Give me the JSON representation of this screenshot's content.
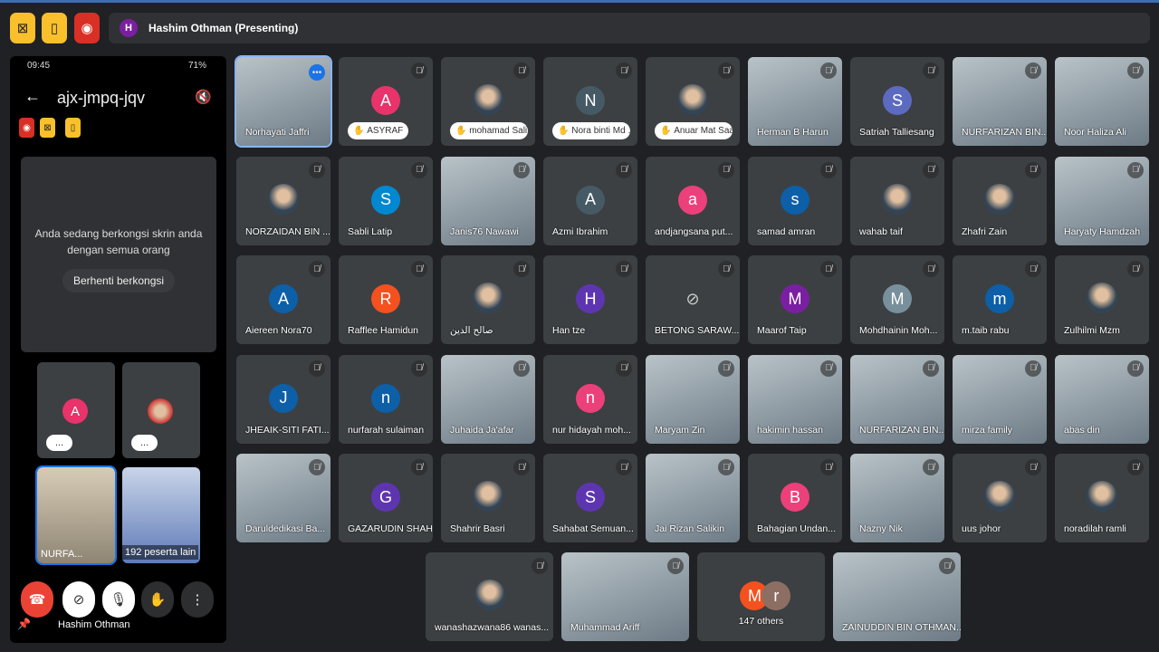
{
  "header": {
    "presenter_initial": "H",
    "presenter_label": "Hashim Othman (Presenting)",
    "icons": [
      "no-screen-icon",
      "door-icon",
      "record-icon"
    ],
    "colors": {
      "yellow": "#f9c02b",
      "red": "#d93025"
    }
  },
  "phone": {
    "time": "09:45",
    "battery": "71%",
    "meeting_code": "ajx-jmpq-jqv",
    "share_message": "Anda sedang berkongsi skrin anda dengan semua orang",
    "stop_sharing": "Berhenti berkongsi",
    "tiles": [
      {
        "letter": "A",
        "label": "...",
        "color": "#e8336b"
      },
      {
        "label": "..."
      },
      {
        "label": "NURFA..."
      },
      {
        "label": "192 peserta lain"
      }
    ],
    "self_name": "Hashim Othman"
  },
  "tiles": [
    {
      "name": "Norhayati Jaffri",
      "kind": "video",
      "sel": true
    },
    {
      "name": "ASYRAF",
      "kind": "avatar",
      "letter": "A",
      "color": "#e8336b",
      "hand": true
    },
    {
      "name": "mohamad Sali...",
      "kind": "photo",
      "hand": true
    },
    {
      "name": "Nora binti Md ...",
      "kind": "avatar",
      "letter": "N",
      "color": "#455a64",
      "hand": true
    },
    {
      "name": "Anuar Mat Saad",
      "kind": "photo",
      "hand": true
    },
    {
      "name": "Herman B Harun",
      "kind": "video"
    },
    {
      "name": "Satriah Talliesang",
      "kind": "avatar",
      "letter": "S",
      "color": "#5c6bc0"
    },
    {
      "name": "NURFARIZAN BIN...",
      "kind": "video"
    },
    {
      "name": "Noor Haliza Ali",
      "kind": "video"
    },
    {
      "name": "NORZAIDAN BIN ...",
      "kind": "photo"
    },
    {
      "name": "Sabli Latip",
      "kind": "avatar",
      "letter": "S",
      "color": "#0288d1"
    },
    {
      "name": "Janis76 Nawawi",
      "kind": "video"
    },
    {
      "name": "Azmi Ibrahim",
      "kind": "avatar",
      "letter": "A",
      "color": "#455a64"
    },
    {
      "name": "andjangsana put...",
      "kind": "avatar",
      "letter": "a",
      "color": "#ec407a"
    },
    {
      "name": "samad amran",
      "kind": "avatar",
      "letter": "s",
      "color": "#0d5fa8"
    },
    {
      "name": "wahab taif",
      "kind": "photo"
    },
    {
      "name": "Zhafri Zain",
      "kind": "photo"
    },
    {
      "name": "Haryaty Hamdzah",
      "kind": "video"
    },
    {
      "name": "Aiereen Nora70",
      "kind": "avatar",
      "letter": "A",
      "color": "#0d5fa8"
    },
    {
      "name": "Rafflee Hamidun",
      "kind": "avatar",
      "letter": "R",
      "color": "#f4511e"
    },
    {
      "name": "صالح الدين",
      "kind": "photo"
    },
    {
      "name": "Han tze",
      "kind": "avatar",
      "letter": "H",
      "color": "#5e35b1"
    },
    {
      "name": "BETONG SARAW...",
      "kind": "camoff"
    },
    {
      "name": "Maarof Taip",
      "kind": "avatar",
      "letter": "M",
      "color": "#7b1fa2"
    },
    {
      "name": "Mohdhainin Moh...",
      "kind": "avatar",
      "letter": "M",
      "color": "#78909c"
    },
    {
      "name": "m.taib rabu",
      "kind": "avatar",
      "letter": "m",
      "color": "#0d5fa8"
    },
    {
      "name": "Zulhilmi Mzm",
      "kind": "photo"
    },
    {
      "name": "JHEAIK-SITI FATI...",
      "kind": "avatar",
      "letter": "J",
      "color": "#0d5fa8"
    },
    {
      "name": "nurfarah sulaiman",
      "kind": "avatar",
      "letter": "n",
      "color": "#0d5fa8"
    },
    {
      "name": "Juhaida Ja'afar",
      "kind": "video"
    },
    {
      "name": "nur hidayah moh...",
      "kind": "avatar",
      "letter": "n",
      "color": "#ec407a"
    },
    {
      "name": "Maryam Zin",
      "kind": "video"
    },
    {
      "name": "hakimin hassan",
      "kind": "video"
    },
    {
      "name": "NURFARIZAN BIN...",
      "kind": "video"
    },
    {
      "name": "mirza family",
      "kind": "video"
    },
    {
      "name": "abas din",
      "kind": "video"
    },
    {
      "name": "Daruldedikasi Ba...",
      "kind": "video"
    },
    {
      "name": "GAZARUDIN SHAH",
      "kind": "avatar",
      "letter": "G",
      "color": "#5e35b1"
    },
    {
      "name": "Shahrir Basri",
      "kind": "photo"
    },
    {
      "name": "Sahabat Semuan...",
      "kind": "avatar",
      "letter": "S",
      "color": "#5e35b1"
    },
    {
      "name": "Jai Rizan Salikin",
      "kind": "video"
    },
    {
      "name": "Bahagian Undan...",
      "kind": "avatar",
      "letter": "B",
      "color": "#ec407a"
    },
    {
      "name": "Nazny Nik",
      "kind": "video"
    },
    {
      "name": "uus johor",
      "kind": "photo"
    },
    {
      "name": "noradilah ramli",
      "kind": "photo"
    }
  ],
  "bottom": [
    {
      "name": "wanashazwana86 wanas...",
      "kind": "photo"
    },
    {
      "name": "Muhammad Ariff",
      "kind": "video"
    },
    {
      "name": "147 others",
      "kind": "others",
      "letters": [
        "M",
        "r"
      ],
      "colors": [
        "#f4511e",
        "#8d6e63"
      ]
    },
    {
      "name": "ZAINUDDIN BIN OTHMAN...",
      "kind": "video"
    }
  ]
}
